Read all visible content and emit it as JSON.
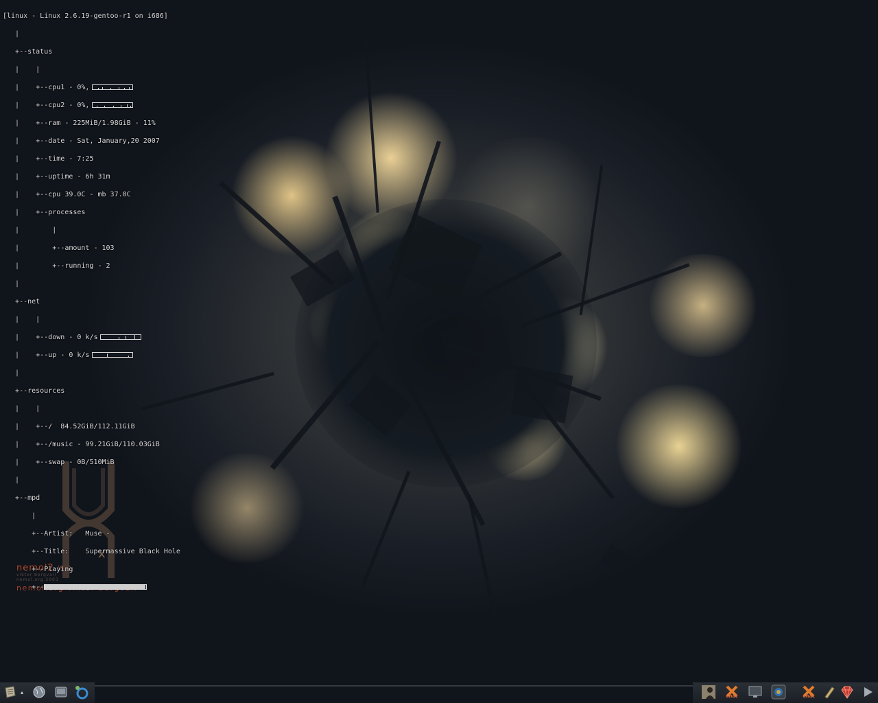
{
  "conky": {
    "header": "[linux - Linux 2.6.19-gentoo-r1 on i686]",
    "status_label": "status",
    "cpu1": "cpu1 - 0%,",
    "cpu2": "cpu2 - 0%,",
    "ram": "ram - 225MiB/1.98GiB - 11%",
    "ram_percent": 11,
    "date": "date - Sat, January,20 2007",
    "time": "time - 7:25",
    "uptime": "uptime - 6h 31m",
    "temp": "cpu 39.0C - mb 37.0C",
    "processes_label": "processes",
    "proc_amount": "amount - 103",
    "proc_running": "running - 2",
    "net_label": "net",
    "net_down": "down - 0 k/s",
    "net_up": "up - 0 k/s",
    "resources_label": "resources",
    "fs_root": "/  84.52GiB/112.11GiB",
    "fs_music": "/music - 99.21GiB/110.03GiB",
    "swap": "swap - 0B/510MiB",
    "mpd_label": "mpd",
    "mpd_artist": "Artist:   Muse -",
    "mpd_title": "Title:    Supermassive Black Hole",
    "mpd_state": "Playing",
    "mpd_progress": 0.99
  },
  "wallpaper": {
    "title": "nemol2",
    "title_suffix": "wp",
    "subtitle1": "viktor bergvall",
    "subtitle2": "nemol.org 2003",
    "credit": "nemol.org viktor bergvall",
    "logo_letter": "x"
  },
  "panel": {
    "left_icons": [
      "menu-icon",
      "globe-icon",
      "terminal-icon",
      "network-icon"
    ],
    "right_icons": [
      "user-icon",
      "chat-icon",
      "monitor-icon",
      "display-icon",
      "chat-icon",
      "pen-icon",
      "gem-icon",
      "play-icon"
    ],
    "chat_label": "chat"
  },
  "colors": {
    "conky_text": "#d8d8d8",
    "credit": "#a8432a",
    "panel": "#22272e"
  }
}
